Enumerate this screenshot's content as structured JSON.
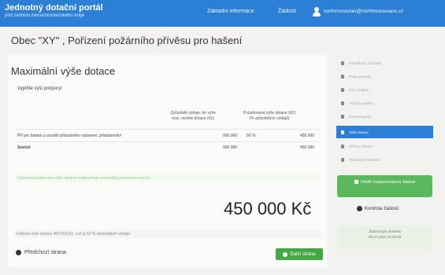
{
  "header": {
    "title": "Jednotný dotační portál",
    "subtitle": "pod záštitou Moravskoslezského kraje",
    "nav_info": "Základní informace",
    "nav_requests": "Žádosti",
    "user_email": "northmoravian@northmoravians.cz"
  },
  "page_title": "Obec \"XY\" , Pořízení požárního přívěsu pro hašení",
  "section": {
    "title": "Maximální výše dotace",
    "instruction": "Vyplňte výši podpory!"
  },
  "table": {
    "headers": [
      "Způsobilé výdaje, do výše max. možné dotace (Kč)",
      "Požadovaná výše dotace (Kč) (% způsobilých výdajů)"
    ],
    "rows": [
      {
        "label": "PP pro hašení a vozidlo příslušného vybavení, příslušenství",
        "eligible": "900 000",
        "percent": "50 %",
        "requested": "450 000"
      },
      {
        "label": "Součet",
        "eligible": "900 000",
        "percent": "",
        "requested": "450 000"
      }
    ]
  },
  "note": "Celková požadovaná výše dotace nepřesahuje maximální povolenou hranici.",
  "total_amount": "450 000 Kč",
  "footnote": "Celková výše dotace 450 000 Kč, což je 50 % způsobilých výdajů.",
  "nav": {
    "prev": "Předchozí strana",
    "next": "Další strana"
  },
  "sidebar": {
    "items": [
      {
        "label": "Identifikace žadatele"
      },
      {
        "label": "Popis projektu"
      },
      {
        "label": "Cíle projektu"
      },
      {
        "label": "Výdaje projektu"
      },
      {
        "label": "Harmonogram"
      },
      {
        "label": "Výše dotace"
      },
      {
        "label": "Přílohy žádosti"
      },
      {
        "label": "Prohlášení žadatele"
      }
    ],
    "active_index": 5,
    "save_button": "Uložit rozpracovanou žádost",
    "check_link": "Kontrola žádosti",
    "saved_label": "Žádost byla uložena",
    "saved_time": "08.07.2022 15:39:08"
  },
  "colors": {
    "header_blue": "#2b7fd4",
    "green": "#45a845"
  }
}
